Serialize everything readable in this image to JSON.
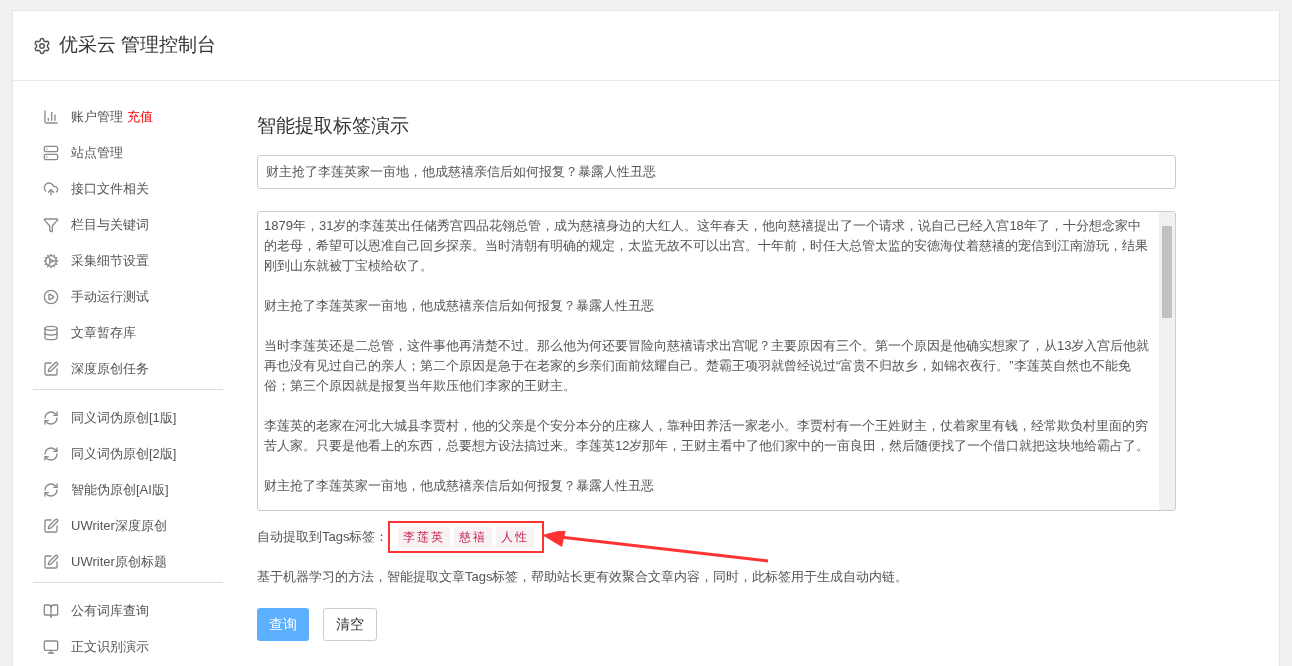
{
  "header": {
    "title": "优采云 管理控制台"
  },
  "sidebar": {
    "groups": [
      [
        {
          "label": "账户管理",
          "badge": "充值"
        },
        {
          "label": "站点管理"
        },
        {
          "label": "接口文件相关"
        },
        {
          "label": "栏目与关键词"
        },
        {
          "label": "采集细节设置"
        },
        {
          "label": "手动运行测试"
        },
        {
          "label": "文章暂存库"
        },
        {
          "label": "深度原创任务"
        }
      ],
      [
        {
          "label": "同义词伪原创[1版]"
        },
        {
          "label": "同义词伪原创[2版]"
        },
        {
          "label": "智能伪原创[AI版]"
        },
        {
          "label": "UWriter深度原创"
        },
        {
          "label": "UWriter原创标题"
        }
      ],
      [
        {
          "label": "公有词库查询"
        },
        {
          "label": "正文识别演示"
        }
      ]
    ]
  },
  "main": {
    "heading": "智能提取标签演示",
    "title_field": {
      "value": "财主抢了李莲英家一亩地，他成慈禧亲信后如何报复？暴露人性丑恶"
    },
    "content_field": {
      "paragraphs": [
        "1879年，31岁的李莲英出任储秀宫四品花翎总管，成为慈禧身边的大红人。这年春天，他向慈禧提出了一个请求，说自己已经入宫18年了，十分想念家中的老母，希望可以恩准自己回乡探亲。当时清朝有明确的规定，太监无故不可以出宫。十年前，时任大总管太监的安德海仗着慈禧的宠信到江南游玩，结果刚到山东就被丁宝桢给砍了。",
        "财主抢了李莲英家一亩地，他成慈禧亲信后如何报复？暴露人性丑恶",
        "当时李莲英还是二总管，这件事他再清楚不过。那么他为何还要冒险向慈禧请求出宫呢？主要原因有三个。第一个原因是他确实想家了，从13岁入宫后他就再也没有见过自己的亲人；第二个原因是急于在老家的乡亲们面前炫耀自己。楚霸王项羽就曾经说过“富贵不归故乡，如锦衣夜行。”李莲英自然也不能免俗；第三个原因就是报复当年欺压他们李家的王财主。",
        "李莲英的老家在河北大城县李贾村，他的父亲是个安分本分的庄稼人，靠种田养活一家老小。李贾村有一个王姓财主，仗着家里有钱，经常欺负村里面的穷苦人家。只要是他看上的东西，总要想方设法搞过来。李莲英12岁那年，王财主看中了他们家中的一亩良田，然后随便找了一个借口就把这块地给霸占了。",
        "财主抢了李莲英家一亩地，他成慈禧亲信后如何报复？暴露人性丑恶"
      ]
    },
    "tags_label": "自动提取到Tags标签：",
    "tags": [
      "李莲英",
      "慈禧",
      "人性"
    ],
    "description": "基于机器学习的方法，智能提取文章Tags标签，帮助站长更有效聚合文章内容，同时，此标签用于生成自动内链。",
    "buttons": [
      {
        "label": "查询",
        "kind": "primary"
      },
      {
        "label": "清空",
        "kind": "default"
      }
    ]
  }
}
